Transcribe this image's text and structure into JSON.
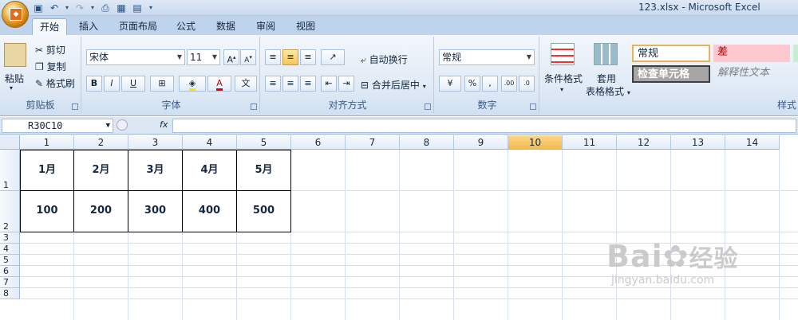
{
  "window": {
    "title": "123.xlsx - Microsoft Excel"
  },
  "tabs": [
    "开始",
    "插入",
    "页面布局",
    "公式",
    "数据",
    "审阅",
    "视图"
  ],
  "ribbon": {
    "clipboard": {
      "label": "剪贴板",
      "paste": "粘贴",
      "cut": "剪切",
      "copy": "复制",
      "format_painter": "格式刷"
    },
    "font": {
      "label": "字体",
      "name": "宋体",
      "size": "11",
      "bold": "B",
      "italic": "I",
      "underline": "U"
    },
    "alignment": {
      "label": "对齐方式",
      "wrap": "自动换行",
      "merge": "合并后居中"
    },
    "number": {
      "label": "数字",
      "format": "常规",
      "percent": "%",
      "comma": ",",
      "inc_decimal": ".00",
      "dec_decimal": ".0"
    },
    "styles": {
      "label": "样式",
      "conditional": "条件格式",
      "table_format_1": "套用",
      "table_format_2": "表格格式",
      "normal": "常规",
      "bad": "差",
      "check_cell": "检查单元格",
      "explanatory": "解释性文本"
    }
  },
  "formula_bar": {
    "name_box": "R30C10",
    "fx": "fx",
    "value": ""
  },
  "columns": [
    "1",
    "2",
    "3",
    "4",
    "5",
    "6",
    "7",
    "8",
    "9",
    "10",
    "11",
    "12",
    "13",
    "14"
  ],
  "selected_column": "10",
  "rows": [
    "1",
    "2",
    "3",
    "4",
    "5",
    "6",
    "7",
    "8"
  ],
  "sheet": {
    "row1": [
      "1月",
      "2月",
      "3月",
      "4月",
      "5月"
    ],
    "row2": [
      "100",
      "200",
      "300",
      "400",
      "500"
    ]
  },
  "watermark": {
    "brand": "Bai",
    "cn": "经验",
    "url": "jingyan.baidu.com"
  },
  "colors": {
    "accent": "#f3b94c",
    "ribbon": "#dfe9f5",
    "tab_bar": "#bfd3ec"
  }
}
